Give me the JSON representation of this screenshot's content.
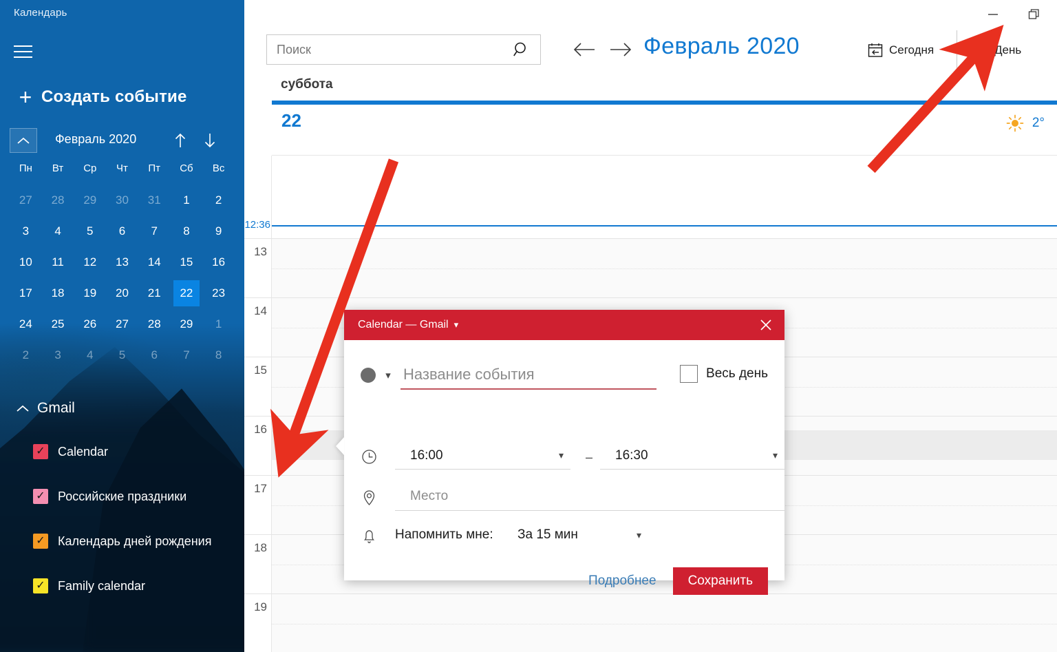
{
  "sidebar": {
    "app_title": "Календарь",
    "menu_icon": "hamburger-icon",
    "new_event_label": "Создать событие",
    "new_event_icon": "plus-icon",
    "mini_calendar": {
      "month_label": "Февраль 2020",
      "collapse_icon": "chevron-up-icon",
      "prev_icon": "arrow-up-icon",
      "next_icon": "arrow-down-icon",
      "weekdays": [
        "Пн",
        "Вт",
        "Ср",
        "Чт",
        "Пт",
        "Сб",
        "Вс"
      ],
      "weeks": [
        [
          {
            "d": "27",
            "dim": true
          },
          {
            "d": "28",
            "dim": true
          },
          {
            "d": "29",
            "dim": true
          },
          {
            "d": "30",
            "dim": true
          },
          {
            "d": "31",
            "dim": true
          },
          {
            "d": "1",
            "dim": false
          },
          {
            "d": "2",
            "dim": false
          }
        ],
        [
          {
            "d": "3",
            "dim": false
          },
          {
            "d": "4",
            "dim": false
          },
          {
            "d": "5",
            "dim": false
          },
          {
            "d": "6",
            "dim": false
          },
          {
            "d": "7",
            "dim": false
          },
          {
            "d": "8",
            "dim": false
          },
          {
            "d": "9",
            "dim": false
          }
        ],
        [
          {
            "d": "10",
            "dim": false
          },
          {
            "d": "11",
            "dim": false
          },
          {
            "d": "12",
            "dim": false
          },
          {
            "d": "13",
            "dim": false
          },
          {
            "d": "14",
            "dim": false
          },
          {
            "d": "15",
            "dim": false
          },
          {
            "d": "16",
            "dim": false
          }
        ],
        [
          {
            "d": "17",
            "dim": false
          },
          {
            "d": "18",
            "dim": false
          },
          {
            "d": "19",
            "dim": false
          },
          {
            "d": "20",
            "dim": false
          },
          {
            "d": "21",
            "dim": false
          },
          {
            "d": "22",
            "dim": false,
            "today": true
          },
          {
            "d": "23",
            "dim": false
          }
        ],
        [
          {
            "d": "24",
            "dim": false
          },
          {
            "d": "25",
            "dim": false
          },
          {
            "d": "26",
            "dim": false
          },
          {
            "d": "27",
            "dim": false
          },
          {
            "d": "28",
            "dim": false
          },
          {
            "d": "29",
            "dim": false
          },
          {
            "d": "1",
            "dim": true
          }
        ],
        [
          {
            "d": "2",
            "dim": true
          },
          {
            "d": "3",
            "dim": true
          },
          {
            "d": "4",
            "dim": true
          },
          {
            "d": "5",
            "dim": true
          },
          {
            "d": "6",
            "dim": true
          },
          {
            "d": "7",
            "dim": true
          },
          {
            "d": "8",
            "dim": true
          }
        ]
      ],
      "today_highlight_color": "#0a84e2"
    },
    "account": {
      "name": "Gmail",
      "collapse_icon": "chevron-up-icon",
      "calendars": [
        {
          "label": "Calendar",
          "color": "#e8425a",
          "checked": true
        },
        {
          "label": "Российские праздники",
          "color": "#f48fb1",
          "checked": true
        },
        {
          "label": "Календарь дней рождения",
          "color": "#f59a23",
          "checked": true
        },
        {
          "label": "Family calendar",
          "color": "#f7e327",
          "checked": true
        }
      ]
    }
  },
  "window_controls": {
    "minimize_icon": "minimize-icon",
    "restore_icon": "restore-icon"
  },
  "toolbar": {
    "search_placeholder": "Поиск",
    "search_value": "",
    "search_icon": "search-icon",
    "prev_icon": "arrow-left-icon",
    "next_icon": "arrow-right-icon",
    "month_title": "Февраль 2020",
    "today_label": "Сегодня",
    "today_icon": "calendar-today-icon",
    "view_label": "День",
    "view_icon": "calendar-day-icon",
    "accent_color": "#1179d1"
  },
  "day_view": {
    "weekday": "суббота",
    "day_number": "22",
    "weather_icon": "sun-icon",
    "weather_temp": "2°",
    "current_time": "12:36",
    "hours": [
      "13",
      "14",
      "15",
      "16",
      "17",
      "18",
      "19"
    ],
    "selected_slot_hour": "16",
    "topbar_color": "#1179d1"
  },
  "event_dialog": {
    "header_title": "Calendar — Gmail",
    "header_chevron_icon": "chevron-down-icon",
    "close_icon": "close-icon",
    "header_color": "#cf2030",
    "color_dot": "#6c6c6c",
    "color_chevron_icon": "chevron-down-icon",
    "title_placeholder": "Название события",
    "title_value": "",
    "allday_label": "Весь день",
    "allday_checked": false,
    "clock_icon": "clock-icon",
    "start_time": "16:00",
    "end_time": "16:30",
    "time_separator": "–",
    "start_chevron_icon": "chevron-down-icon",
    "end_chevron_icon": "chevron-down-icon",
    "place_icon": "location-pin-icon",
    "place_placeholder": "Место",
    "place_value": "",
    "bell_icon": "bell-icon",
    "remind_label": "Напомнить мне:",
    "remind_value": "За 15 мин",
    "remind_chevron_icon": "chevron-down-icon",
    "more_link": "Подробнее",
    "save_label": "Сохранить"
  },
  "annotations": {
    "arrow_color": "#e8301f",
    "arrow_1_target": "selected-slot-16-00",
    "arrow_2_target": "day-view-button"
  }
}
